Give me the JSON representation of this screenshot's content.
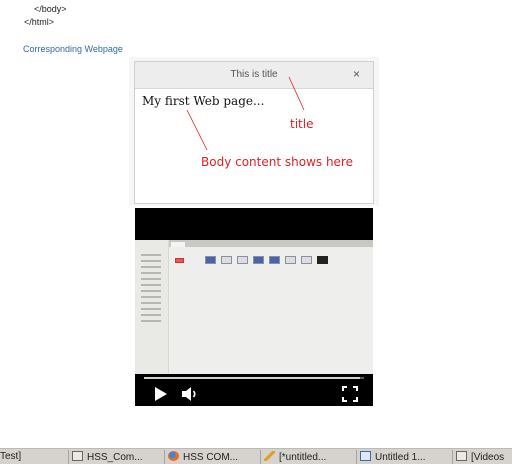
{
  "code": {
    "body_close": "</body>",
    "html_close": "</html>"
  },
  "link_text": "Corresponding Webpage",
  "preview": {
    "window_title": "This is title",
    "close_symbol": "×",
    "body_text": "My first Web page...",
    "annotation_title": "title",
    "annotation_body": "Body content shows here",
    "annotation_color": "#e02020"
  },
  "video": {
    "progress_fraction": 0.98
  },
  "taskbar": {
    "items": [
      {
        "label": "Test]",
        "icon": "none"
      },
      {
        "label": "HSS_Com...",
        "icon": "window-icon"
      },
      {
        "label": "HSS COM...",
        "icon": "firefox-icon"
      },
      {
        "label": "[*untitled...",
        "icon": "pencil-icon"
      },
      {
        "label": "Untitled 1...",
        "icon": "document-icon"
      },
      {
        "label": "[Videos",
        "icon": "window-icon"
      }
    ]
  }
}
